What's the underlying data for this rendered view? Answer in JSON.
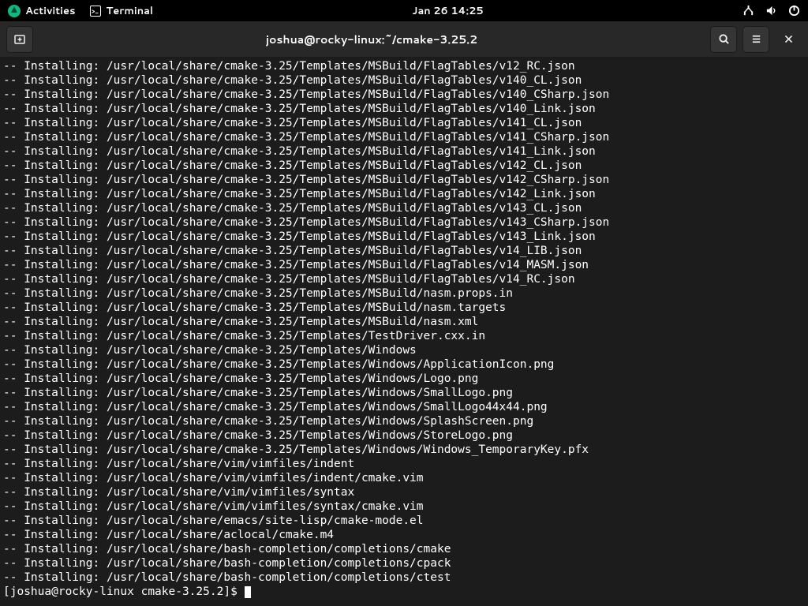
{
  "topbar": {
    "activities": "Activities",
    "app_name": "Terminal",
    "clock": "Jan 26  14:25"
  },
  "window": {
    "title": "joshua@rocky-linux:~/cmake-3.25.2"
  },
  "terminal": {
    "prefix": "-- Installing: ",
    "base_path": "/usr/local/share/",
    "lines": [
      "cmake-3.25/Templates/MSBuild/FlagTables/v12_RC.json",
      "cmake-3.25/Templates/MSBuild/FlagTables/v140_CL.json",
      "cmake-3.25/Templates/MSBuild/FlagTables/v140_CSharp.json",
      "cmake-3.25/Templates/MSBuild/FlagTables/v140_Link.json",
      "cmake-3.25/Templates/MSBuild/FlagTables/v141_CL.json",
      "cmake-3.25/Templates/MSBuild/FlagTables/v141_CSharp.json",
      "cmake-3.25/Templates/MSBuild/FlagTables/v141_Link.json",
      "cmake-3.25/Templates/MSBuild/FlagTables/v142_CL.json",
      "cmake-3.25/Templates/MSBuild/FlagTables/v142_CSharp.json",
      "cmake-3.25/Templates/MSBuild/FlagTables/v142_Link.json",
      "cmake-3.25/Templates/MSBuild/FlagTables/v143_CL.json",
      "cmake-3.25/Templates/MSBuild/FlagTables/v143_CSharp.json",
      "cmake-3.25/Templates/MSBuild/FlagTables/v143_Link.json",
      "cmake-3.25/Templates/MSBuild/FlagTables/v14_LIB.json",
      "cmake-3.25/Templates/MSBuild/FlagTables/v14_MASM.json",
      "cmake-3.25/Templates/MSBuild/FlagTables/v14_RC.json",
      "cmake-3.25/Templates/MSBuild/nasm.props.in",
      "cmake-3.25/Templates/MSBuild/nasm.targets",
      "cmake-3.25/Templates/MSBuild/nasm.xml",
      "cmake-3.25/Templates/TestDriver.cxx.in",
      "cmake-3.25/Templates/Windows",
      "cmake-3.25/Templates/Windows/ApplicationIcon.png",
      "cmake-3.25/Templates/Windows/Logo.png",
      "cmake-3.25/Templates/Windows/SmallLogo.png",
      "cmake-3.25/Templates/Windows/SmallLogo44x44.png",
      "cmake-3.25/Templates/Windows/SplashScreen.png",
      "cmake-3.25/Templates/Windows/StoreLogo.png",
      "cmake-3.25/Templates/Windows/Windows_TemporaryKey.pfx",
      "vim/vimfiles/indent",
      "vim/vimfiles/indent/cmake.vim",
      "vim/vimfiles/syntax",
      "vim/vimfiles/syntax/cmake.vim",
      "emacs/site-lisp/cmake-mode.el",
      "aclocal/cmake.m4",
      "bash-completion/completions/cmake",
      "bash-completion/completions/cpack",
      "bash-completion/completions/ctest"
    ],
    "prompt": "[joshua@rocky-linux cmake-3.25.2]$ "
  }
}
